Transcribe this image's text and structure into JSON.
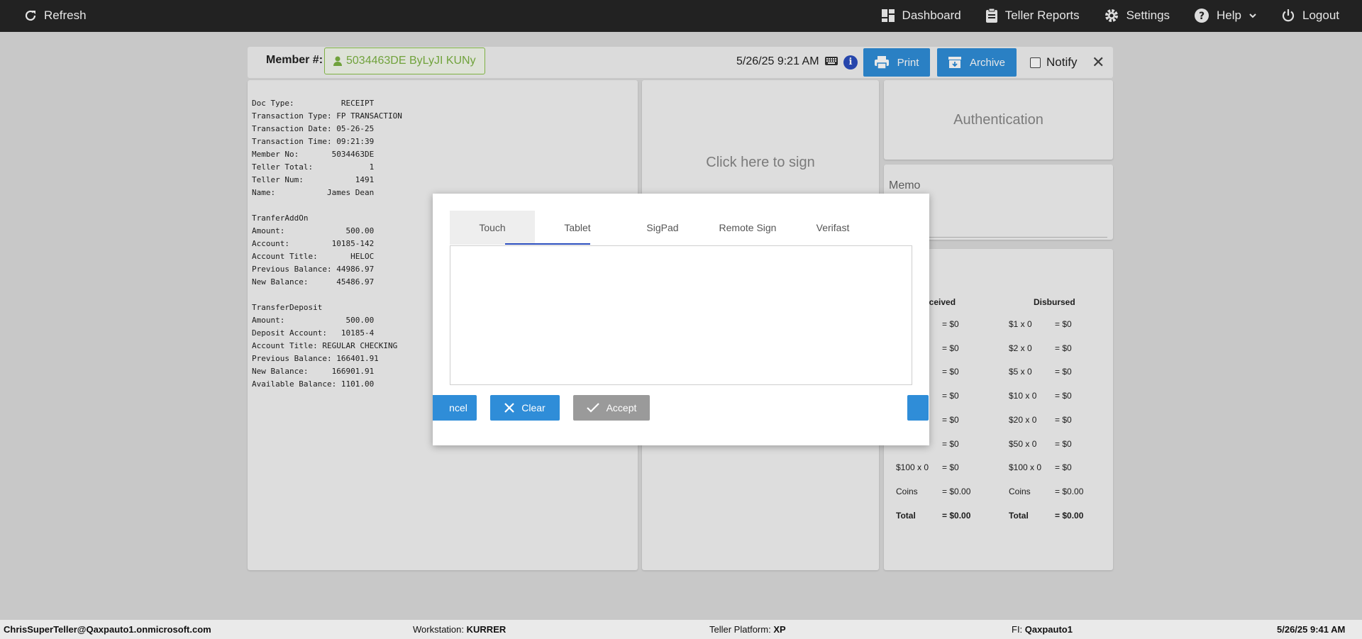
{
  "topbar": {
    "refresh": "Refresh",
    "dashboard": "Dashboard",
    "teller_reports": "Teller Reports",
    "settings": "Settings",
    "help": "Help",
    "logout": "Logout"
  },
  "member": {
    "label": "Member #:",
    "value": "5034463DE ByLyJI KUNy"
  },
  "toolbar": {
    "datetime": "5/26/25 9:21 AM",
    "print": "Print",
    "archive": "Archive",
    "notify": "Notify"
  },
  "receipt": {
    "lines": [
      [
        "Doc Type:",
        "RECEIPT"
      ],
      [
        "Transaction Type:",
        "FP TRANSACTION"
      ],
      [
        "Transaction Date:",
        "05-26-25"
      ],
      [
        "Transaction Time:",
        "09:21:39"
      ],
      [
        "Member No:",
        "5034463DE"
      ],
      [
        "Teller Total:",
        "1"
      ],
      [
        "Teller Num:",
        "1491"
      ],
      [
        "Name:",
        "James Dean"
      ],
      [
        "",
        ""
      ],
      [
        "TranferAddOn",
        ""
      ],
      [
        "Amount:",
        "500.00"
      ],
      [
        "Account:",
        "10185-142"
      ],
      [
        "Account Title:",
        "HELOC"
      ],
      [
        "Previous Balance:",
        "44986.97"
      ],
      [
        "New Balance:",
        "45486.97"
      ],
      [
        "",
        ""
      ],
      [
        "TransferDeposit",
        ""
      ],
      [
        "Amount:",
        "500.00"
      ],
      [
        "Deposit Account:",
        "10185-4"
      ],
      [
        "Account Title:",
        "REGULAR CHECKING"
      ],
      [
        "Previous Balance:",
        "166401.91"
      ],
      [
        "New Balance:",
        "166901.91"
      ],
      [
        "Available Balance:",
        "1101.00"
      ]
    ]
  },
  "sign_panel": {
    "text": "Click here to sign"
  },
  "auth_panel": {
    "text": "Authentication"
  },
  "memo_panel": {
    "label": "Memo"
  },
  "cash": {
    "received_header": "eceived",
    "disbursed_header": "Disbursed",
    "received": [
      [
        "",
        "= $0"
      ],
      [
        "",
        "= $0"
      ],
      [
        "",
        "= $0"
      ],
      [
        "",
        "= $0"
      ],
      [
        "",
        "= $0"
      ],
      [
        "",
        "= $0"
      ],
      [
        "$100 x 0",
        "= $0"
      ],
      [
        "Coins",
        "= $0.00"
      ],
      [
        "Total",
        "= $0.00"
      ]
    ],
    "disbursed": [
      [
        "$1 x 0",
        "= $0"
      ],
      [
        "$2 x 0",
        "= $0"
      ],
      [
        "$5 x 0",
        "= $0"
      ],
      [
        "$10 x 0",
        "= $0"
      ],
      [
        "$20 x 0",
        "= $0"
      ],
      [
        "$50 x 0",
        "= $0"
      ],
      [
        "$100 x 0",
        "= $0"
      ],
      [
        "Coins",
        "= $0.00"
      ],
      [
        "Total",
        "= $0.00"
      ]
    ]
  },
  "modal": {
    "tabs": [
      "Touch",
      "Tablet",
      "SigPad",
      "Remote Sign",
      "Verifast"
    ],
    "cancel": "ncel",
    "clear": "Clear",
    "accept": "Accept"
  },
  "statusbar": {
    "user": "ChrisSuperTeller@Qaxpauto1.onmicrosoft.com",
    "workstation_label": "Workstation:",
    "workstation": "KURRER",
    "platform_label": "Teller Platform:",
    "platform": "XP",
    "fi_label": "FI:",
    "fi": "Qaxpauto1",
    "datetime": "5/26/25 9:41 AM"
  },
  "colors": {
    "topbar": "#222222",
    "accent_blue": "#2f8dd8",
    "tab_indicator": "#2a4dbd",
    "member_green": "#7cb342"
  }
}
